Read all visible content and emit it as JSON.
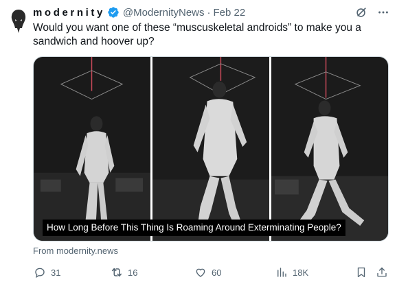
{
  "author": {
    "display_name": "modernity",
    "handle": "@ModernityNews",
    "separator": "·",
    "date": "Feb 22",
    "verified_color": "#1d9bf0"
  },
  "tweet": {
    "text": "Would you want one of these “muscuskeletal androids” to make you a sandwich and hoover up?"
  },
  "media": {
    "caption": "How Long Before This Thing Is Roaming Around Exterminating People?",
    "source": "From modernity.news"
  },
  "actions": {
    "replies": "31",
    "retweets": "16",
    "likes": "60",
    "views": "18K"
  },
  "icons": [
    "verified-badge-icon",
    "grok-icon",
    "more-icon",
    "reply-icon",
    "retweet-icon",
    "like-icon",
    "views-icon",
    "bookmark-icon",
    "share-icon"
  ]
}
